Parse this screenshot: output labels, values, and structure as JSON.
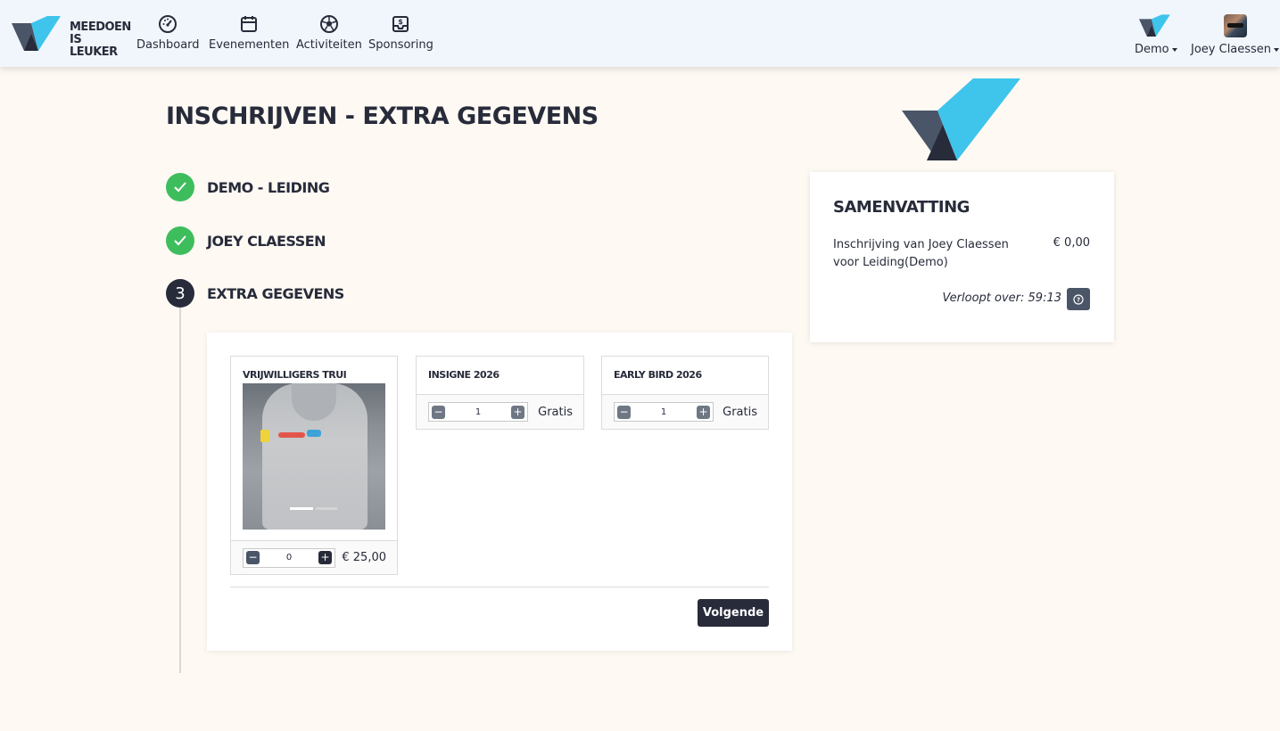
{
  "brand": {
    "line1": "MEEDOEN",
    "line2": "IS LEUKER"
  },
  "nav": {
    "items": [
      {
        "label": "Dashboard",
        "icon": "dashboard-gauge-icon"
      },
      {
        "label": "Evenementen",
        "icon": "calendar-icon"
      },
      {
        "label": "Activiteiten",
        "icon": "soccer-ball-icon"
      },
      {
        "label": "Sponsoring",
        "icon": "sponsoring-inbox-icon"
      }
    ],
    "org": "Demo",
    "user": "Joey Claessen"
  },
  "page": {
    "title": "Inschrijven - extra gegevens"
  },
  "steps": [
    {
      "label": "Demo - Leiding",
      "state": "done"
    },
    {
      "label": "Joey Claessen",
      "state": "done"
    },
    {
      "label": "Extra gegevens",
      "state": "active",
      "number": "3"
    }
  ],
  "products": [
    {
      "name": "Vrijwilligers trui",
      "quantity": "0",
      "price": "€ 25,00"
    },
    {
      "name": "Insigne 2026",
      "quantity": "1",
      "price": "Gratis"
    },
    {
      "name": "Early Bird 2026",
      "quantity": "1",
      "price": "Gratis"
    }
  ],
  "actions": {
    "next": "Volgende"
  },
  "summary": {
    "title": "Samenvatting",
    "line": "Inschrijving van Joey Claessen voor Leiding(Demo)",
    "price": "€ 0,00",
    "expires": "Verloopt over: 59:13"
  },
  "colors": {
    "navy": "#272b3a",
    "green": "#3ebd5d",
    "brand_blue": "#3fc4ec",
    "brand_slate": "#4a5568",
    "background": "#fef9f3"
  }
}
